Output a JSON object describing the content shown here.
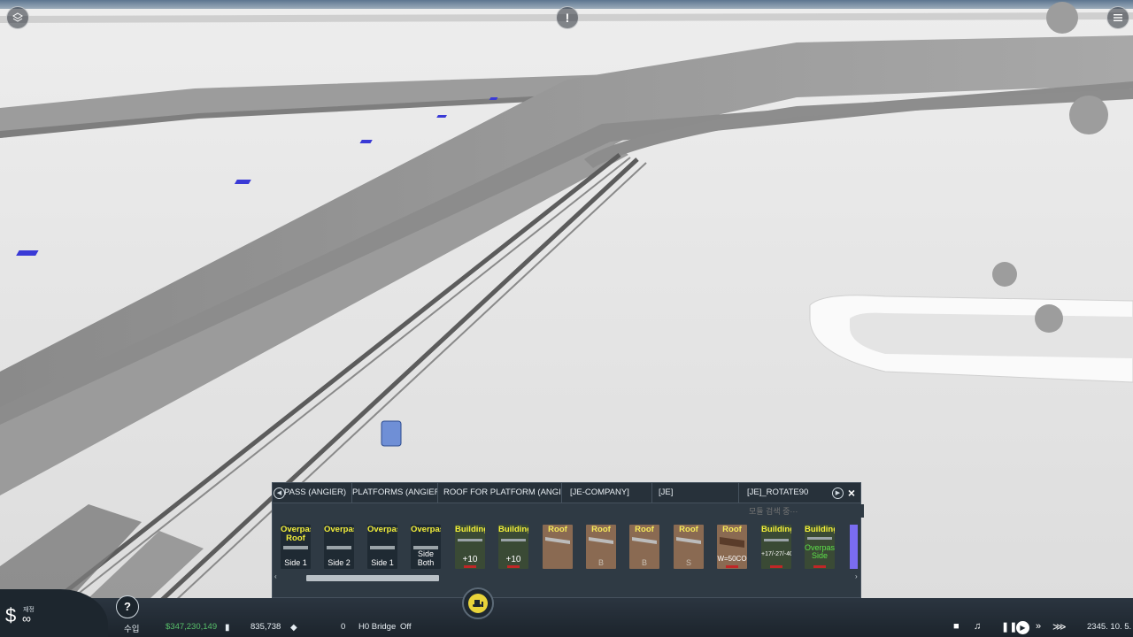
{
  "asset_panel": {
    "tabs": [
      {
        "label": "PASS (ANGIER)"
      },
      {
        "label": "PLATFORMS (ANGIER)"
      },
      {
        "label": "ROOF FOR PLATFORM (ANGIER)"
      },
      {
        "label": "[JE-COMPANY]"
      },
      {
        "label": "[JE]"
      },
      {
        "label": "[JE]_ROTATE90"
      }
    ],
    "close_label": "×",
    "search_placeholder": "모듈 검색 중···",
    "thumbnails": [
      {
        "top": "Overpass Roof",
        "bottom": "Side 1",
        "style": "dark"
      },
      {
        "top": "Overpass",
        "bottom": "Side 2",
        "style": "dark"
      },
      {
        "top": "Overpass",
        "bottom": "Side 1",
        "style": "dark"
      },
      {
        "top": "Overpass",
        "bottom": "Side Both",
        "style": "dark"
      },
      {
        "top": "Building",
        "bottom": "+10",
        "style": "green"
      },
      {
        "top": "Building",
        "bottom": "+10",
        "style": "green"
      },
      {
        "top": "Roof",
        "bottom": "",
        "style": "brown"
      },
      {
        "top": "Roof",
        "bottom": "B",
        "style": "brown"
      },
      {
        "top": "Roof",
        "bottom": "B",
        "style": "brown"
      },
      {
        "top": "Roof",
        "bottom": "S",
        "style": "brown"
      },
      {
        "top": "Roof",
        "bottom": "W=50CO",
        "style": "brown"
      },
      {
        "top": "Building",
        "bottom": "+17/-27/-40",
        "style": "green"
      },
      {
        "top": "Building",
        "bottom": "Overpass Side",
        "style": "green"
      }
    ]
  },
  "bottom_bar": {
    "money_label": "재정",
    "money_value": "∞",
    "help_label": "?",
    "income_label": "수입",
    "income_value": "$347,230,149",
    "population_value": "835,738",
    "cargo_value": "0",
    "bridge_label": "H0 Bridge",
    "bridge_state": "Off",
    "date": "2345. 10. 5."
  },
  "colors": {
    "panel_bg": "#2f3a44",
    "money_green": "#58c06a",
    "bulldoze_yellow": "#e9d43a",
    "label_yellow": "#f2ee3a"
  },
  "icons": [
    "layers-icon",
    "warning-icon",
    "menu-icon",
    "dollar-icon",
    "bulldozer-icon",
    "population-icon",
    "cargo-icon",
    "camera-icon",
    "music-icon",
    "pause-icon",
    "play-icon",
    "fast-forward-icon",
    "faster-forward-icon"
  ]
}
